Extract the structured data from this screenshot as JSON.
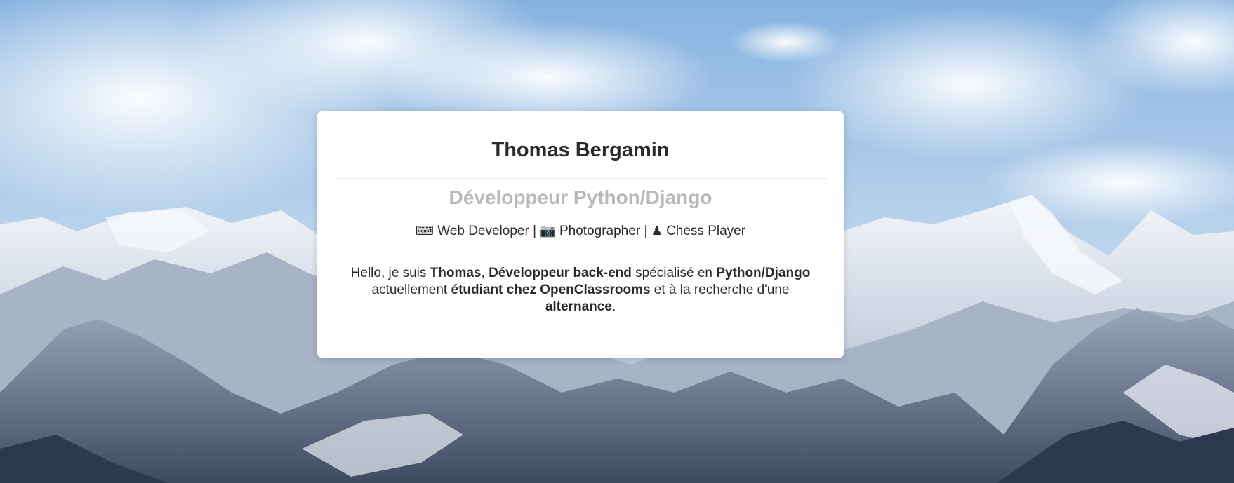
{
  "profile": {
    "name": "Thomas Bergamin",
    "subtitle": "Développeur Python/Django",
    "tagline": {
      "icon1": "⌨",
      "role1": "Web Developer",
      "sep1": "|",
      "icon2": "📷",
      "role2": "Photographer",
      "sep2": "|",
      "icon3": "♟",
      "role3": "Chess Player"
    },
    "bio": {
      "t1": "Hello, je suis ",
      "b1": "Thomas",
      "t2": ", ",
      "b2": "Développeur back-end",
      "t3": " spécialisé en ",
      "b3": "Python/Django",
      "t4": " actuellement ",
      "b4": "étudiant chez OpenClassrooms",
      "t5": " et à la recherche d'une ",
      "b5": "alternance",
      "t6": "."
    }
  },
  "background": {
    "description_icon": "mountain-landscape",
    "sky_color": "#a9c6e6",
    "snow_color": "#eef2f7",
    "rock_color": "#5f6b82"
  }
}
